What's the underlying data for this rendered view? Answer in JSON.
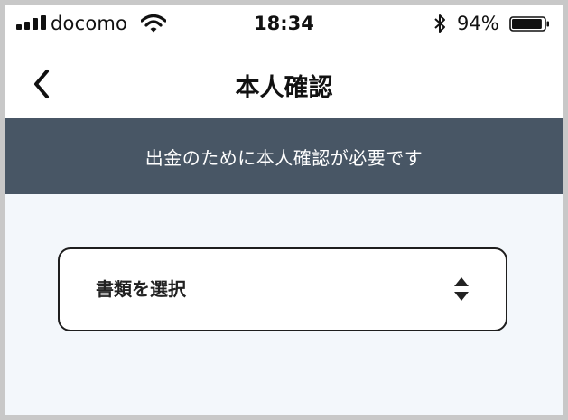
{
  "status_bar": {
    "carrier": "docomo",
    "time": "18:34",
    "battery_percent": "94%",
    "battery_level": 0.94,
    "signal_bars": 4,
    "icons": [
      "signal-icon",
      "wifi-icon",
      "bluetooth-icon",
      "battery-icon"
    ]
  },
  "nav": {
    "title": "本人確認",
    "back_icon": "chevron-left-icon"
  },
  "banner": {
    "message": "出金のために本人確認が必要です"
  },
  "document_select": {
    "selected_label": "書類を選択",
    "icon": "sort-arrows-icon"
  },
  "colors": {
    "banner_bg": "#485665",
    "content_bg": "#f3f7fb",
    "text": "#111111"
  }
}
